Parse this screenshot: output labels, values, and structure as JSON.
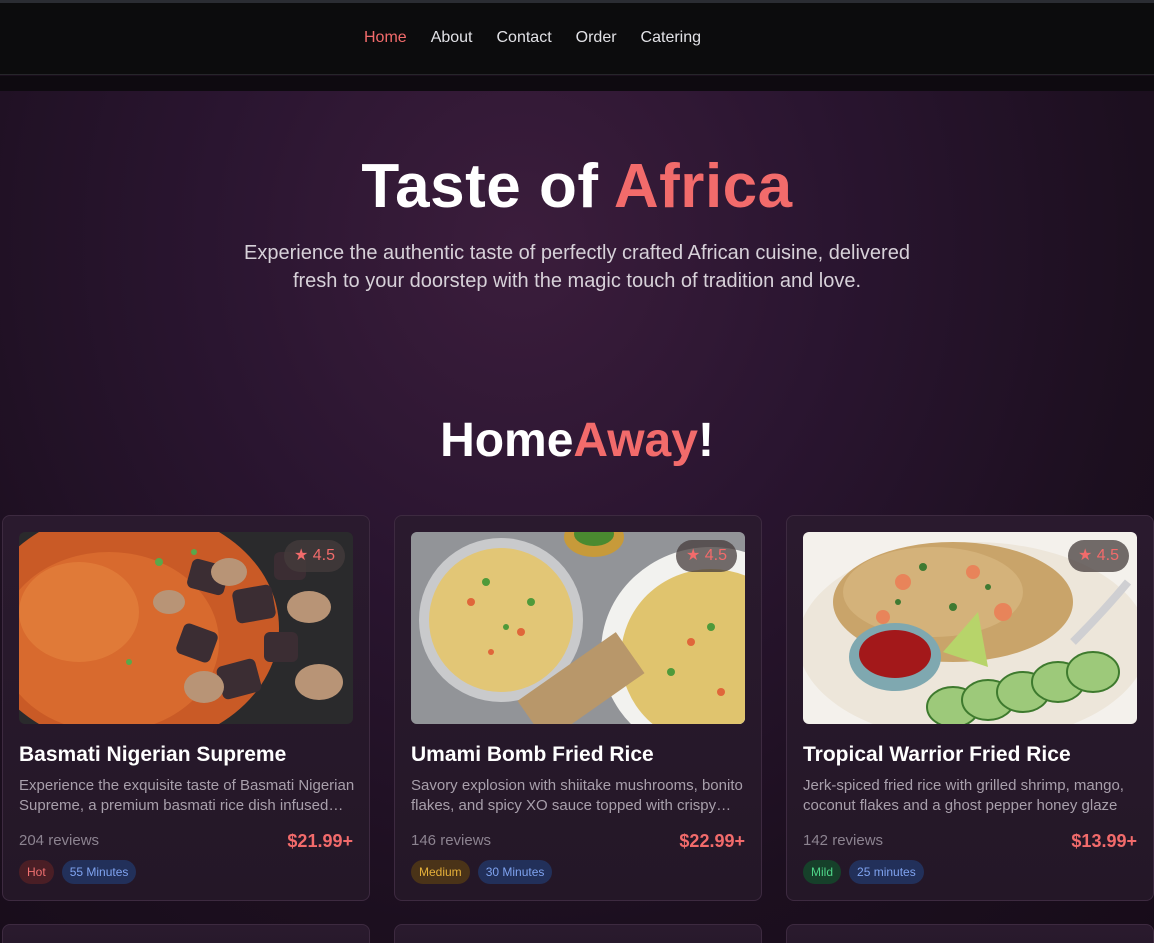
{
  "nav": {
    "links": [
      {
        "label": "Home",
        "active": true
      },
      {
        "label": "About",
        "active": false
      },
      {
        "label": "Contact",
        "active": false
      },
      {
        "label": "Order",
        "active": false
      },
      {
        "label": "Catering",
        "active": false
      }
    ]
  },
  "hero": {
    "title_main": "Taste of ",
    "title_accent": "Africa",
    "subtitle": "Experience the authentic taste of perfectly crafted African cuisine, delivered fresh to your doorstep with the magic touch of tradition and love."
  },
  "section": {
    "title_a": "Home",
    "title_b": "Away",
    "title_c": "!"
  },
  "colors": {
    "accent": "#f26b6b",
    "background": "#1a0f1c",
    "card_border": "#3d2a40"
  },
  "cards": [
    {
      "rating": "★ 4.5",
      "title": "Basmati Nigerian Supreme",
      "description": "Experience the exquisite taste of Basmati Nigerian Supreme, a premium basmati rice dish infused with rich spices",
      "reviews": "204 reviews",
      "price": "$21.99+",
      "spice": "Hot",
      "time": "55 Minutes",
      "image": "jollof-rice-with-meat"
    },
    {
      "rating": "★ 4.5",
      "title": "Umami Bomb Fried Rice",
      "description": "Savory explosion with shiitake mushrooms, bonito flakes, and spicy XO sauce topped with crispy shallots",
      "reviews": "146 reviews",
      "price": "$22.99+",
      "spice": "Medium",
      "time": "30 Minutes",
      "image": "fried-rice-bowls"
    },
    {
      "rating": "★ 4.5",
      "title": "Tropical Warrior Fried Rice",
      "description": "Jerk-spiced fried rice with grilled shrimp, mango, coconut flakes and a ghost pepper honey glaze",
      "reviews": "142 reviews",
      "price": "$13.99+",
      "spice": "Mild",
      "time": "25 minutes",
      "image": "shrimp-fried-rice-with-cucumber"
    }
  ]
}
